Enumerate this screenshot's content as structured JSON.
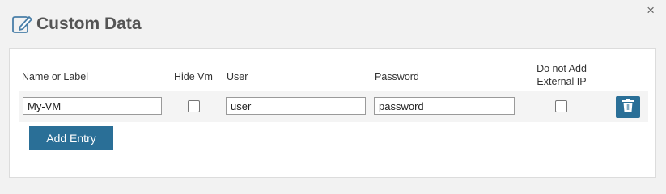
{
  "dialog": {
    "title": "Custom Data",
    "title_icon": "edit-icon",
    "close_glyph": "×"
  },
  "table": {
    "headers": {
      "name": "Name or Label",
      "hide_vm": "Hide Vm",
      "user": "User",
      "password": "Password",
      "no_external_ip_line1": "Do not Add",
      "no_external_ip_line2": "External IP"
    },
    "rows": [
      {
        "name": "My-VM",
        "hide_vm": false,
        "user": "user",
        "password": "password",
        "no_external_ip": false,
        "delete_icon": "trash-icon"
      }
    ]
  },
  "actions": {
    "add_entry_label": "Add Entry"
  },
  "colors": {
    "accent": "#2a6f97",
    "background": "#f2f2f2",
    "panel": "#ffffff",
    "row": "#f4f4f4"
  }
}
